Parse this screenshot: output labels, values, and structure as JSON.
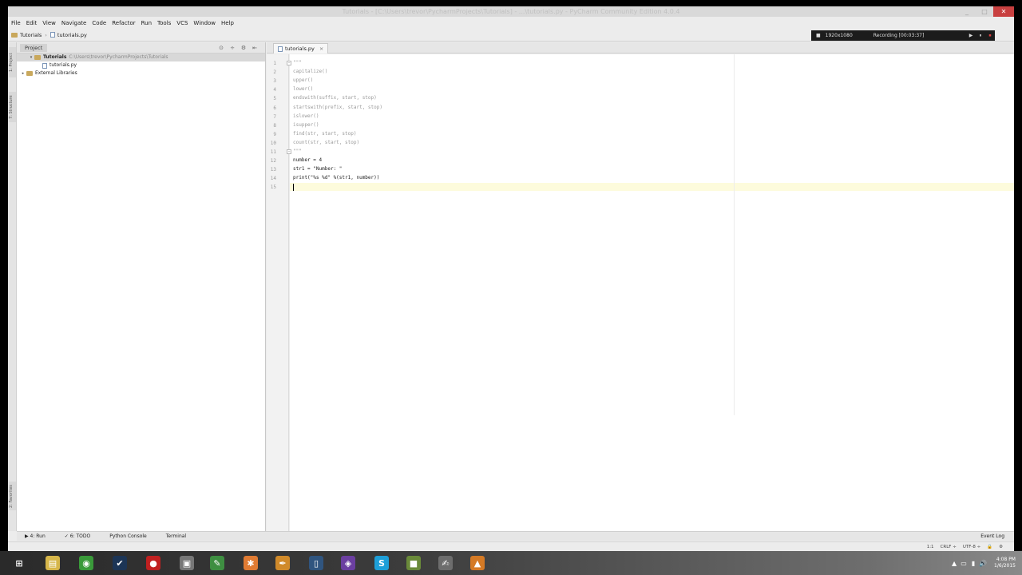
{
  "window": {
    "title": "Tutorials - [C:\\Users\\trevor\\PycharmProjects\\Tutorials] - ...\\tutorials.py - PyCharm Community Edition 4.0.4",
    "minimize": "_",
    "maximize": "□",
    "close": "✕"
  },
  "menu": [
    "File",
    "Edit",
    "View",
    "Navigate",
    "Code",
    "Refactor",
    "Run",
    "Tools",
    "VCS",
    "Window",
    "Help"
  ],
  "nav": {
    "project": "Tutorials",
    "file": "tutorials.py"
  },
  "recorder": {
    "resolution": "1920x1080",
    "status": "Recording [00:03:37]",
    "buttons": [
      "▶",
      "⏸",
      "⏹"
    ]
  },
  "left_strip": {
    "project_tab": "1: Project",
    "structure_tab": "7: Structure",
    "favorites_tab": "2: Favorites"
  },
  "project_panel": {
    "tab": "Project",
    "tools": [
      "⊙",
      "÷",
      "⚙",
      "⇤"
    ],
    "tree": [
      {
        "label": "Tutorials",
        "path": "C:\\Users\\trevor\\PycharmProjects\\Tutorials",
        "arrow": "▾",
        "indent": 1,
        "selected": true,
        "kind": "folder"
      },
      {
        "label": "tutorials.py",
        "path": "",
        "arrow": "",
        "indent": 2,
        "selected": false,
        "kind": "file"
      },
      {
        "label": "External Libraries",
        "path": "",
        "arrow": "▸",
        "indent": 0,
        "selected": false,
        "kind": "library"
      }
    ]
  },
  "editor": {
    "tab_label": "tutorials.py",
    "tab_close": "×",
    "line_numbers": [
      "1",
      "2",
      "3",
      "4",
      "5",
      "6",
      "7",
      "8",
      "9",
      "10",
      "11",
      "12",
      "13",
      "14",
      "15"
    ],
    "lines": [
      {
        "text": "\"\"\"",
        "style": "doc"
      },
      {
        "text": "capitalize()",
        "style": "doc"
      },
      {
        "text": "upper()",
        "style": "doc"
      },
      {
        "text": "lower()",
        "style": "doc"
      },
      {
        "text": "endswith(suffix, start, stop)",
        "style": "doc"
      },
      {
        "text": "startswith(prefix, start, stop)",
        "style": "doc"
      },
      {
        "text": "islower()",
        "style": "doc"
      },
      {
        "text": "isupper()",
        "style": "doc"
      },
      {
        "text": "find(str, start, stop)",
        "style": "doc"
      },
      {
        "text": "count(str, start, stop)",
        "style": "doc"
      },
      {
        "text": "\"\"\"",
        "style": "doc"
      },
      {
        "text": "number = 4",
        "style": "code"
      },
      {
        "text": "str1 = \"Number: \"",
        "style": "code"
      },
      {
        "text": "print(\"%s %d\" %(str1, number))",
        "style": "code"
      },
      {
        "text": "",
        "style": "code"
      }
    ],
    "current_line": 15
  },
  "bottom_tabs": [
    "▶ 4: Run",
    "✓ 6: TODO",
    "Python Console",
    "Terminal"
  ],
  "event_log": "Event Log",
  "status": [
    "1:1",
    "CRLF ÷",
    "UTF-8 ÷",
    "🔒",
    "⚙"
  ],
  "taskbar": {
    "icons": [
      {
        "name": "windows-start-icon",
        "glyph": "⊞",
        "color": "#2b2b2b"
      },
      {
        "name": "file-explorer-icon",
        "glyph": "▤",
        "color": "#d6b64a"
      },
      {
        "name": "chrome-icon",
        "glyph": "◉",
        "color": "#3a9a3a"
      },
      {
        "name": "steam-icon",
        "glyph": "✔",
        "color": "#1c3556"
      },
      {
        "name": "record-icon",
        "glyph": "●",
        "color": "#c02020"
      },
      {
        "name": "monitor-icon",
        "glyph": "▣",
        "color": "#777777"
      },
      {
        "name": "notepad-icon",
        "glyph": "✎",
        "color": "#3e8e41"
      },
      {
        "name": "xampp-icon",
        "glyph": "✱",
        "color": "#e07b33"
      },
      {
        "name": "pen-tool-icon",
        "glyph": "✒",
        "color": "#d08a2a"
      },
      {
        "name": "document-icon",
        "glyph": "▯",
        "color": "#30557f"
      },
      {
        "name": "visual-studio-icon",
        "glyph": "◈",
        "color": "#6b3fa0"
      },
      {
        "name": "skype-icon",
        "glyph": "S",
        "color": "#1e9fd8"
      },
      {
        "name": "minecraft-icon",
        "glyph": "■",
        "color": "#6a8a3a"
      },
      {
        "name": "brush-icon",
        "glyph": "✍",
        "color": "#6d6d6d"
      },
      {
        "name": "pycharm-icon",
        "glyph": "▲",
        "color": "#d57a25"
      }
    ],
    "tray": [
      "▲",
      "▭",
      "▮",
      "🔊"
    ],
    "time": "4:08 PM",
    "date": "1/6/2015"
  }
}
